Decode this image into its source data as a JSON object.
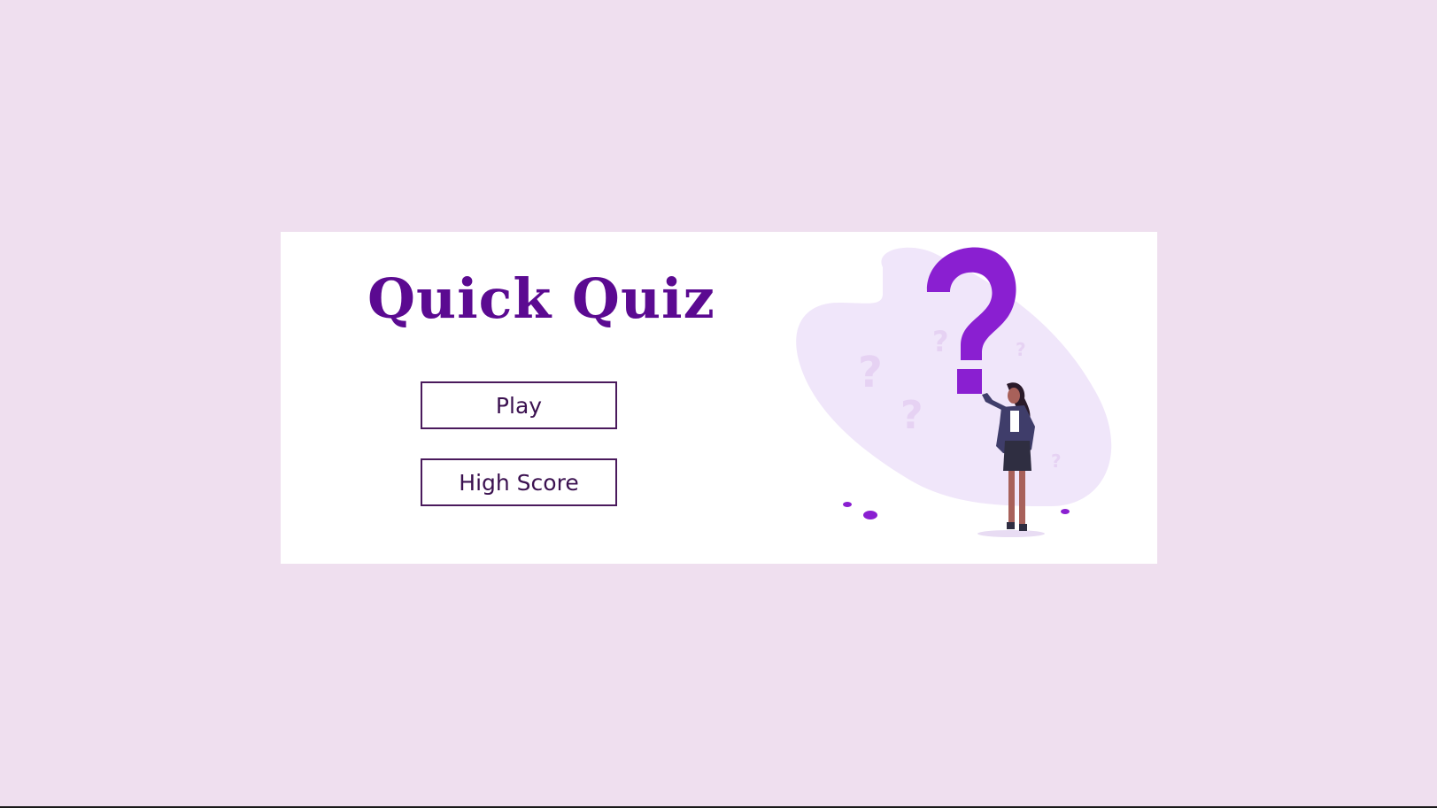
{
  "app": {
    "title": "Quick Quiz"
  },
  "menu": {
    "play_label": "Play",
    "high_score_label": "High Score"
  },
  "illustration": {
    "name": "woman-with-question-mark-illustration"
  },
  "colors": {
    "background": "#efdfef",
    "card": "#ffffff",
    "title": "#5b0a91",
    "button_border": "#4a1a5c",
    "button_text": "#3b1150",
    "accent": "#8a1fd1"
  }
}
